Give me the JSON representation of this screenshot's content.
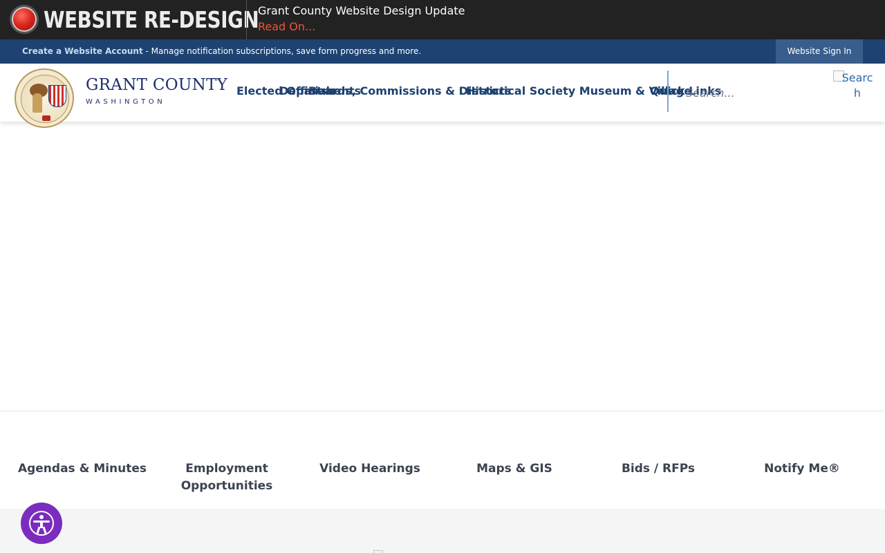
{
  "alert": {
    "title": "WEBSITE RE-DESIGN",
    "headline": "Grant County Website Design Update",
    "link": "Read On..."
  },
  "account_bar": {
    "create_link": "Create a Website Account",
    "description": " - Manage notification subscriptions, save form progress and more.",
    "sign_in": "Website Sign In"
  },
  "header": {
    "brand_name": "GRANT COUNTY",
    "brand_sub": "WASHINGTON",
    "nav": [
      {
        "label": "Elected Officials"
      },
      {
        "label": "Departments"
      },
      {
        "label": "Boards, Commissions & Districts"
      },
      {
        "label": "Historical Society Museum & Village"
      },
      {
        "label": "Quick Links"
      }
    ],
    "search_placeholder": "Search...",
    "search_button_alt": "Search"
  },
  "quick_links": [
    {
      "label": "Agendas & Minutes"
    },
    {
      "label": "Employment Opportunities"
    },
    {
      "label": "Video Hearings"
    },
    {
      "label": "Maps & GIS"
    },
    {
      "label": "Bids / RFPs"
    },
    {
      "label": "Notify Me®"
    }
  ],
  "colors": {
    "alert_bg": "#222222",
    "alert_link": "#f0523a",
    "account_bar_bg": "#1e4271",
    "nav_text": "#1d4170",
    "brand_text": "#1c2f6b",
    "accessibility_button": "#7b2cbf"
  },
  "icons": {
    "alert": "alert-light-icon",
    "accessibility": "accessibility-person-icon",
    "seal": "county-seal-logo"
  }
}
